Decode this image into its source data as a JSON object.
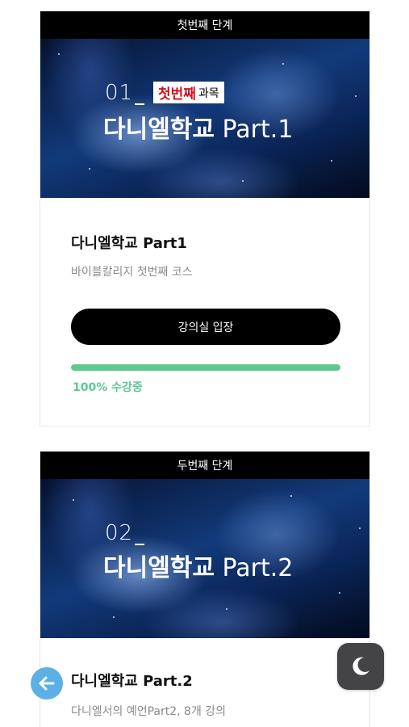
{
  "cards": [
    {
      "stage": "첫번째 단계",
      "banner": {
        "number": "01",
        "badge_highlight": "첫번째",
        "badge_rest": "과목",
        "title_kr": "다니엘학교",
        "title_en": "Part.1"
      },
      "title": "다니엘학교 Part1",
      "subtitle": "바이블칼리지 첫번째 코스",
      "button_label": "강의실 입장",
      "progress_percent": 100,
      "progress_label": "100% 수강중"
    },
    {
      "stage": "두번째 단계",
      "banner": {
        "number": "02",
        "title_kr": "다니엘학교",
        "title_en": "Part.2"
      },
      "title": "다니엘학교 Part.2",
      "subtitle": "다니엘서의 예언Part2, 8개 강의"
    }
  ],
  "floating": {
    "back_icon": "arrow-left-icon",
    "theme_icon": "moon-icon"
  },
  "colors": {
    "accent_green": "#5ec88f",
    "badge_red": "#d30f1f",
    "back_blue": "#5db0e6",
    "dark_button": "#444446"
  }
}
